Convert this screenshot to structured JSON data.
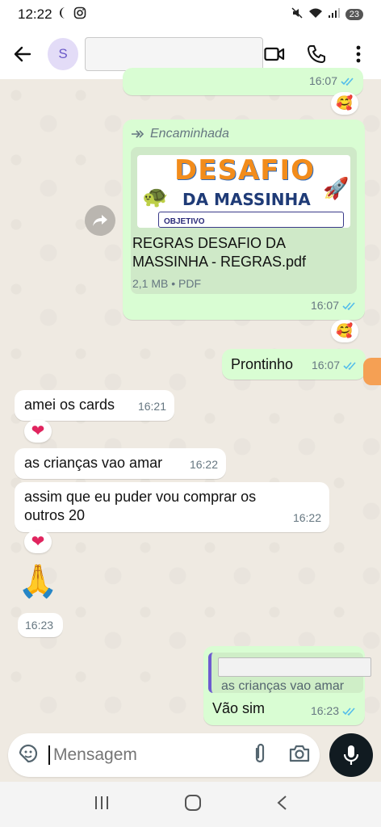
{
  "status_bar": {
    "time": "12:22",
    "battery": "23"
  },
  "header": {
    "avatar_letter": "S",
    "contact_name": ""
  },
  "messages": {
    "top_partial": {
      "time": "16:07",
      "reaction": "🥰"
    },
    "forwarded_doc": {
      "forwarded_label": "Encaminhada",
      "preview_title": "DESAFIO",
      "preview_subtitle": "DA MASSINHA",
      "preview_objective": "OBJETIVO",
      "file_name": "REGRAS DESAFIO DA MASSINHA - REGRAS.pdf",
      "file_info": "2,1 MB • PDF",
      "time": "16:07",
      "reaction": "🥰"
    },
    "prontinho": {
      "text": "Prontinho",
      "time": "16:07"
    },
    "amei": {
      "text": "amei os cards",
      "time": "16:21",
      "reaction": "❤"
    },
    "criancas": {
      "text": "as crianças vao amar",
      "time": "16:22"
    },
    "assim": {
      "text": "assim que eu puder vou comprar os outros 20",
      "time": "16:22",
      "reaction": "❤"
    },
    "pray": {
      "emoji": "🙏",
      "time": "16:23"
    },
    "reply": {
      "quoted_text": "as crianças vao amar",
      "text": "Vão sim",
      "time": "16:23"
    }
  },
  "composer": {
    "placeholder": "Mensagem"
  },
  "colors": {
    "outgoing": "#d9fdd3",
    "incoming": "#ffffff",
    "read_ticks": "#53bdeb",
    "mic": "#111b21"
  }
}
